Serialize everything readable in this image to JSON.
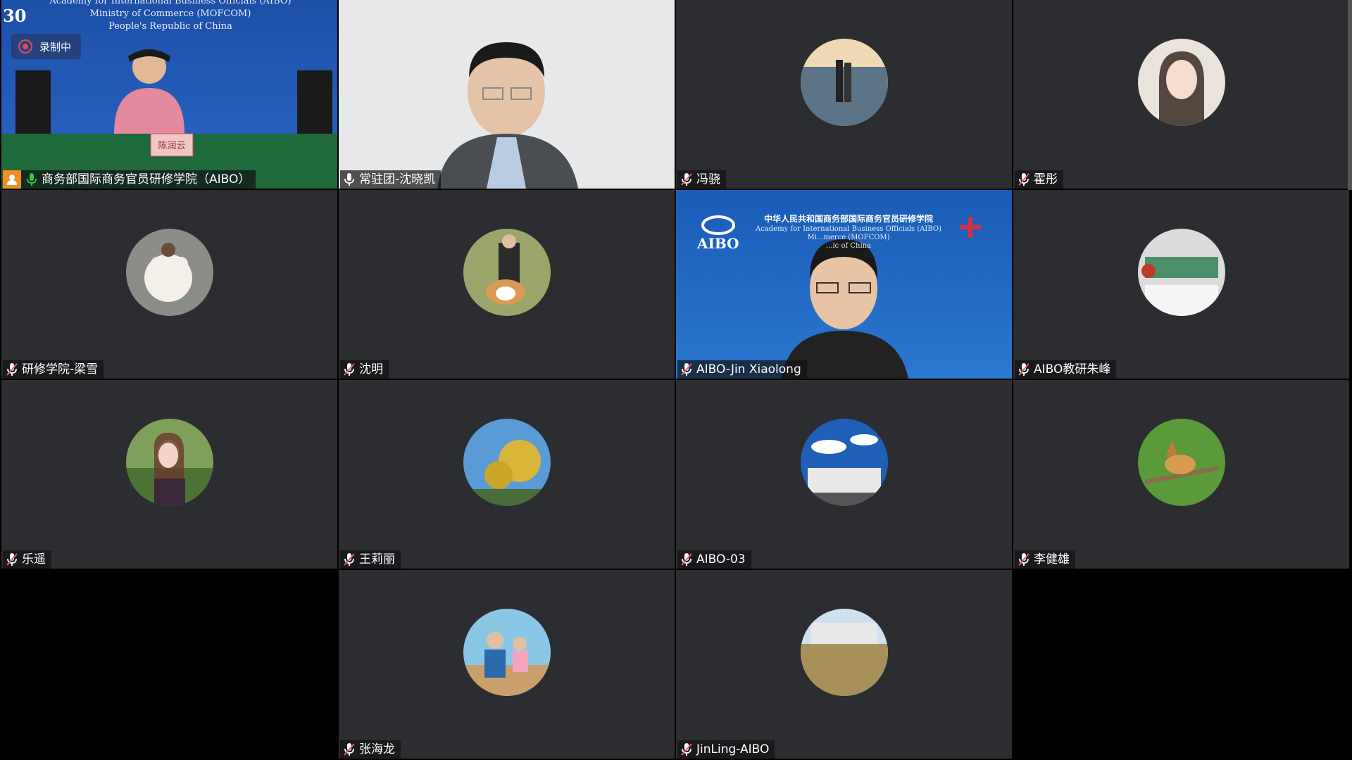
{
  "recording": {
    "label": "录制中"
  },
  "tiles": [
    {
      "name": "商务部国际商务官员研修学院（AIBO）",
      "kind": "video-host",
      "mic": "active",
      "backdrop_lines": [
        "Academy for International Business Officials (AIBO)",
        "Ministry of Commerce (MOFCOM)",
        "People's Republic of China"
      ],
      "backdrop_fragment": "30",
      "nameplate_card": "陈润云"
    },
    {
      "name": "常驻团-沈晓凯",
      "kind": "video-webcam",
      "mic": "on"
    },
    {
      "name": "冯骁",
      "kind": "avatar",
      "mic": "muted",
      "avatar": "couple-by-sea"
    },
    {
      "name": "霍彤",
      "kind": "avatar",
      "mic": "muted",
      "avatar": "woman-portrait"
    },
    {
      "name": "研修学院-梁雪",
      "kind": "avatar",
      "mic": "muted",
      "avatar": "child-with-bear"
    },
    {
      "name": "沈明",
      "kind": "avatar",
      "mic": "muted",
      "avatar": "man-with-corgi"
    },
    {
      "name": "AIBO-Jin Xiaolong",
      "kind": "video-branded",
      "mic": "muted",
      "backdrop_title": "中华人民共和国商务部国际商务官员研修学院",
      "backdrop_lines": [
        "Academy for International Business Officials (AIBO)",
        "Mi...merce (MOFCOM)",
        "...ic of China"
      ],
      "logo_text": "AIBO"
    },
    {
      "name": "AIBO教研朱峰",
      "kind": "avatar",
      "mic": "muted",
      "avatar": "shelf-decor"
    },
    {
      "name": "乐遥",
      "kind": "avatar",
      "mic": "muted",
      "avatar": "woman-outdoors"
    },
    {
      "name": "王莉丽",
      "kind": "avatar",
      "mic": "muted",
      "avatar": "yellow-blossoms"
    },
    {
      "name": "AIBO-03",
      "kind": "avatar",
      "mic": "muted",
      "avatar": "building-sky"
    },
    {
      "name": "李健雄",
      "kind": "avatar",
      "mic": "muted",
      "avatar": "hoopoe-bird"
    },
    {
      "name": "",
      "kind": "empty"
    },
    {
      "name": "张海龙",
      "kind": "avatar",
      "mic": "muted",
      "avatar": "father-daughter-beach"
    },
    {
      "name": "JinLing-AIBO",
      "kind": "avatar",
      "mic": "muted",
      "avatar": "building-trees"
    },
    {
      "name": "",
      "kind": "empty"
    }
  ],
  "colors": {
    "tile_bg": "#2c2d30",
    "host_badge": "#f28c28",
    "mic_active": "#2ecc40",
    "muted_mic": "#e35d6a",
    "active_border": "#2ea44f"
  }
}
